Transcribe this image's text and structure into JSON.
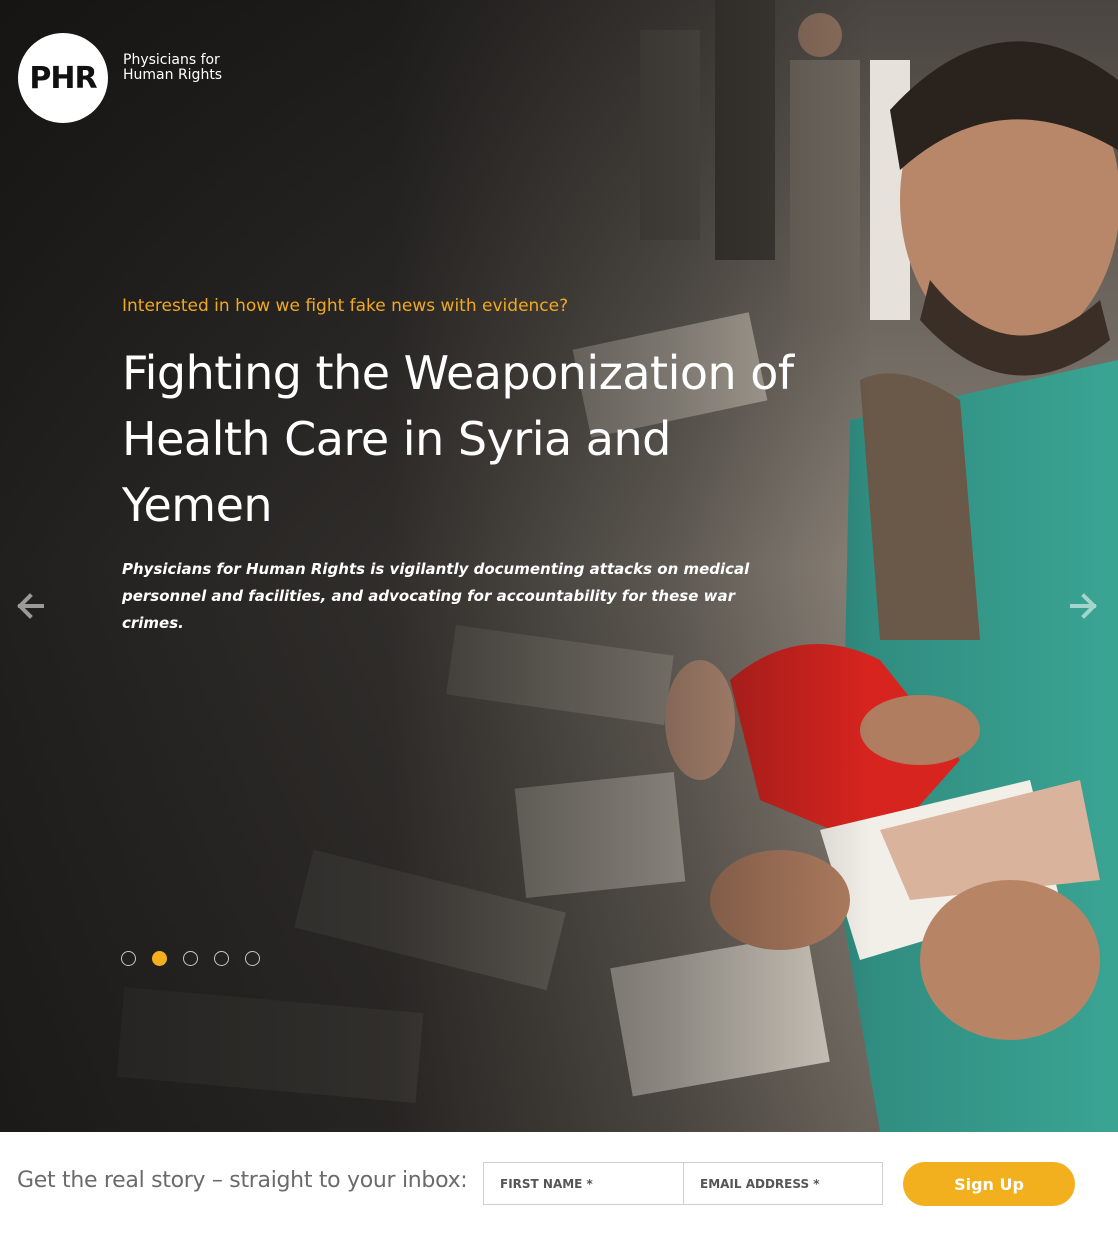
{
  "brand": {
    "logo_abbr": "PHR",
    "logo_name": "Physicians for Human Rights"
  },
  "slide": {
    "kicker": "Interested in how we fight fake news with evidence?",
    "headline": "Fighting the Weaponization of Health Care in Syria and Yemen",
    "summary": "Physicians for Human Rights is vigilantly documenting attacks on medical personnel and facilities, and advocating for accountability for these war crimes.",
    "current_index": 2,
    "total_slides": 5
  },
  "carousel": {
    "prev_icon": "arrow-left-icon",
    "next_icon": "arrow-right-icon",
    "dots": [
      {
        "active": false
      },
      {
        "active": true
      },
      {
        "active": false
      },
      {
        "active": false
      },
      {
        "active": false
      }
    ]
  },
  "signup": {
    "label": "Get the real story – straight to your inbox:",
    "first_name_placeholder": "FIRST NAME *",
    "email_placeholder": "EMAIL ADDRESS *",
    "button_label": "Sign Up"
  },
  "colors": {
    "accent": "#f2b01e",
    "kicker": "#f2a91d",
    "label_gray": "#6b6b6b"
  }
}
